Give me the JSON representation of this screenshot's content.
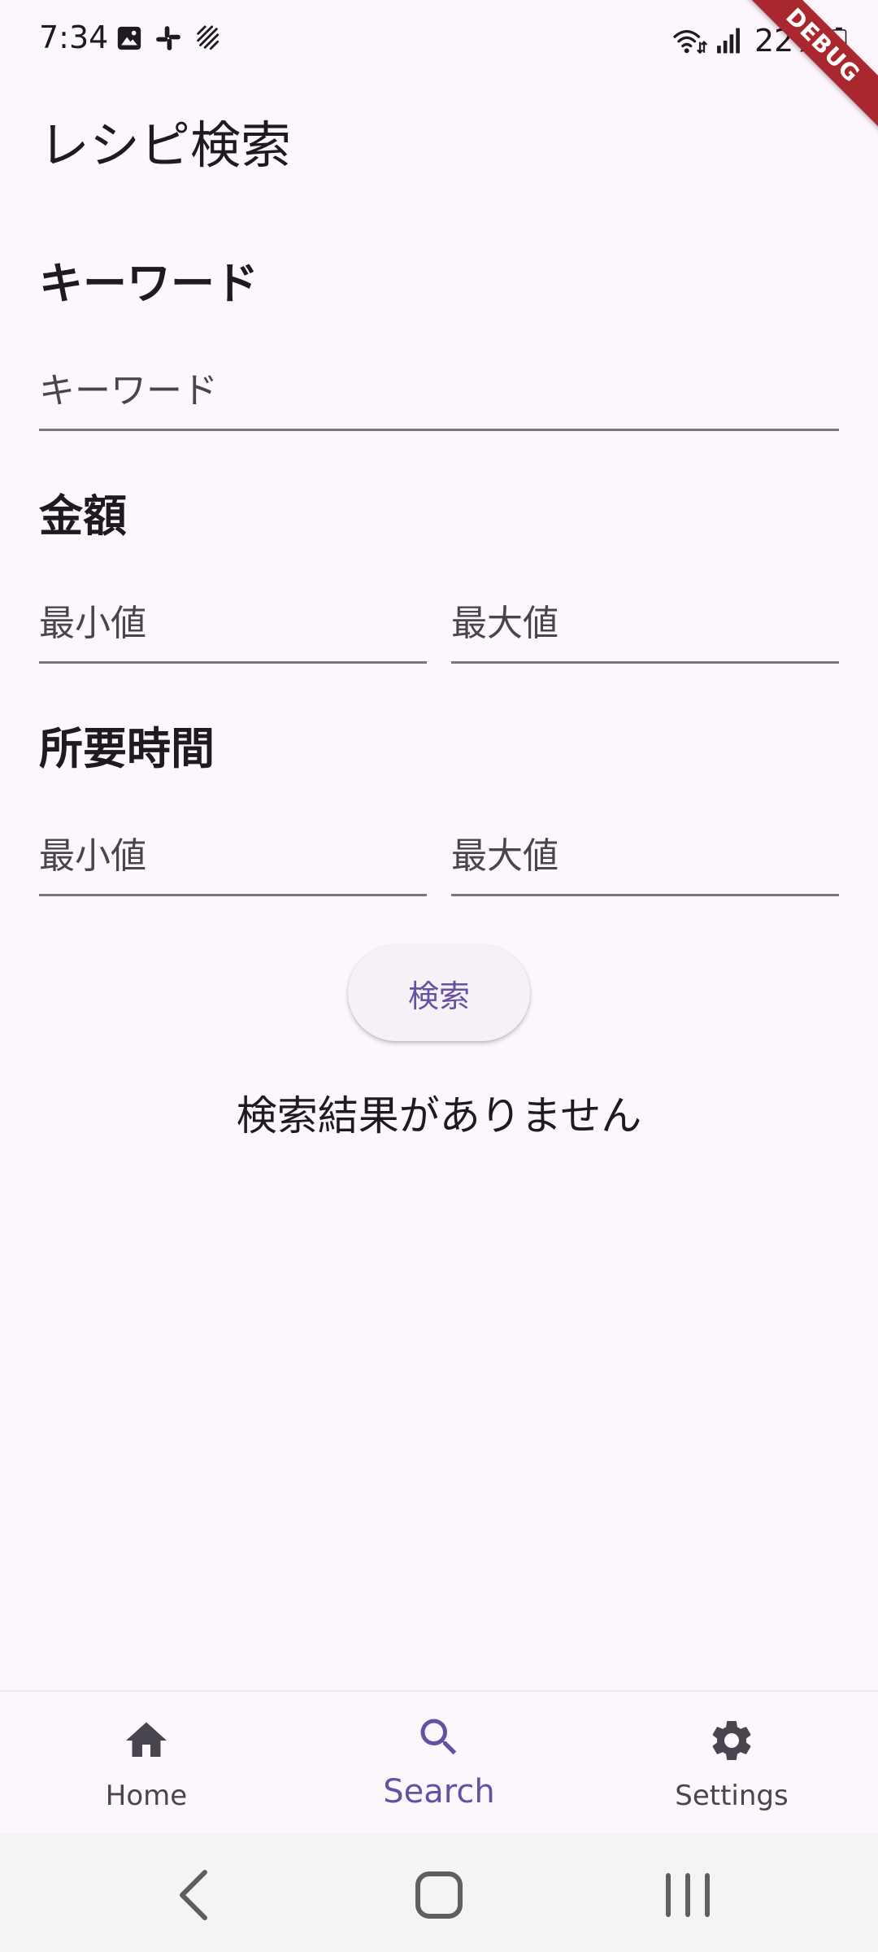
{
  "status_bar": {
    "time": "7:34",
    "battery": "22%",
    "left_icons": [
      "image-icon",
      "slack-icon",
      "stripes-icon"
    ],
    "right_icons": [
      "wifi-icon",
      "signal-icon",
      "battery-icon"
    ]
  },
  "debug_banner": "DEBUG",
  "app_bar": {
    "title": "レシピ検索"
  },
  "form": {
    "keyword": {
      "heading": "キーワード",
      "placeholder": "キーワード"
    },
    "price": {
      "heading": "金額",
      "min_placeholder": "最小値",
      "max_placeholder": "最大値"
    },
    "time": {
      "heading": "所要時間",
      "min_placeholder": "最小値",
      "max_placeholder": "最大値"
    },
    "search_button": "検索"
  },
  "results": {
    "empty_message": "検索結果がありません"
  },
  "bottom_nav": {
    "items": [
      {
        "label": "Home",
        "icon": "home-icon",
        "active": false
      },
      {
        "label": "Search",
        "icon": "search-icon",
        "active": true
      },
      {
        "label": "Settings",
        "icon": "gear-icon",
        "active": false
      }
    ]
  },
  "colors": {
    "background": "#fdf7fd",
    "accent": "#6750a4",
    "text": "#1d1b20",
    "muted": "#49454f",
    "divider": "#79747e",
    "debug": "#a8282d"
  }
}
